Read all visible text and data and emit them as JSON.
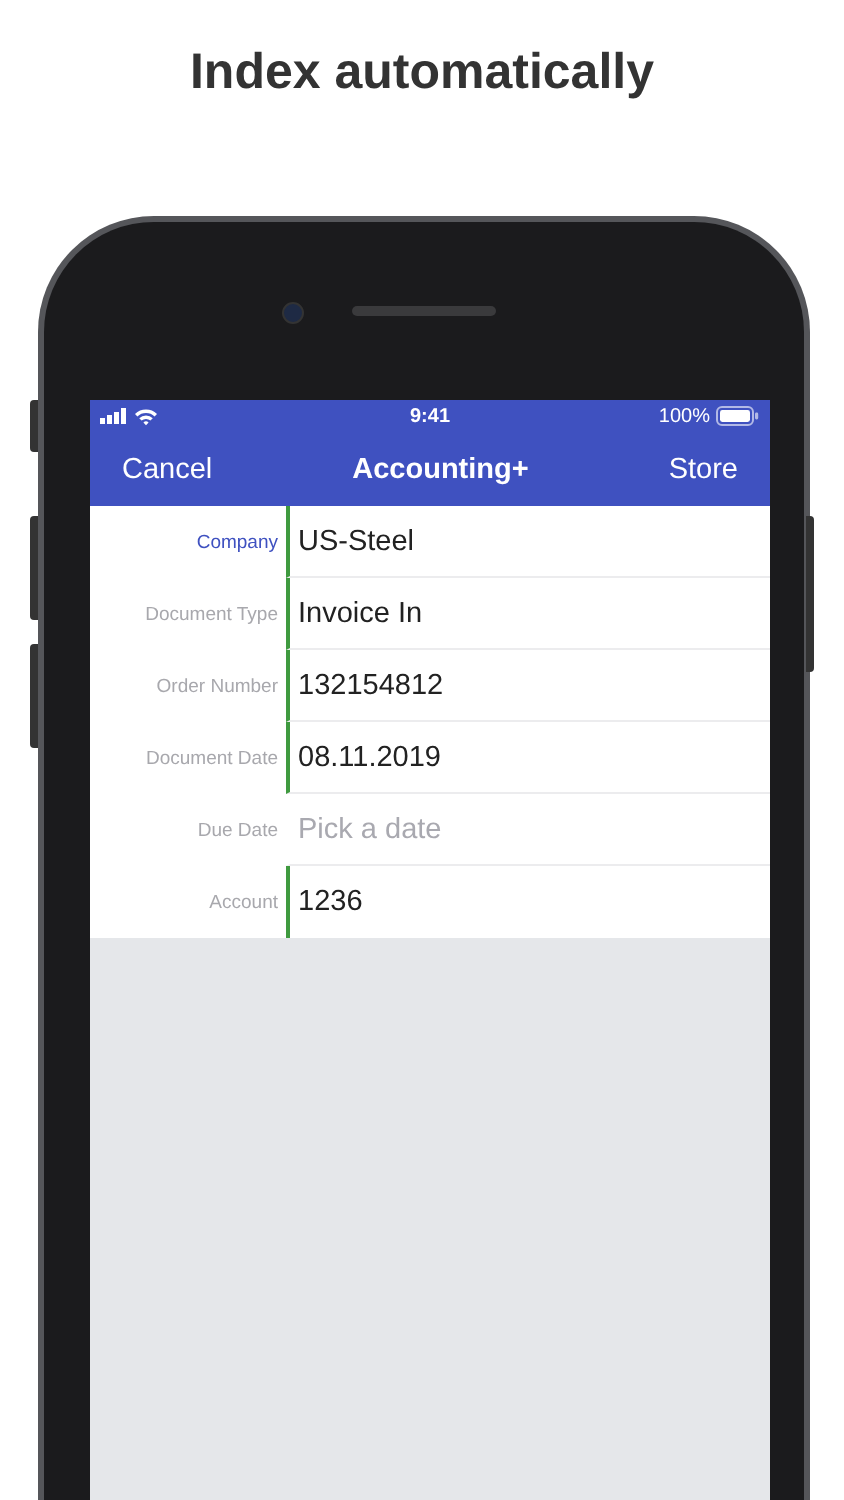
{
  "headline": "Index automatically",
  "status_bar": {
    "time": "9:41",
    "battery": "100%"
  },
  "nav_bar": {
    "left_button": "Cancel",
    "title": "Accounting+",
    "right_button": "Store"
  },
  "fields": [
    {
      "label": "Company",
      "value": "US-Steel",
      "selected": true
    },
    {
      "label": "Document Type",
      "value": "Invoice In",
      "selected": false
    },
    {
      "label": "Order Number",
      "value": "132154812",
      "selected": false
    },
    {
      "label": "Document Date",
      "value": "08.11.2019",
      "selected": false
    },
    {
      "label": "Due Date",
      "placeholder": "Pick a date",
      "selected": false
    },
    {
      "label": "Account",
      "value": "1236",
      "selected": false
    }
  ]
}
